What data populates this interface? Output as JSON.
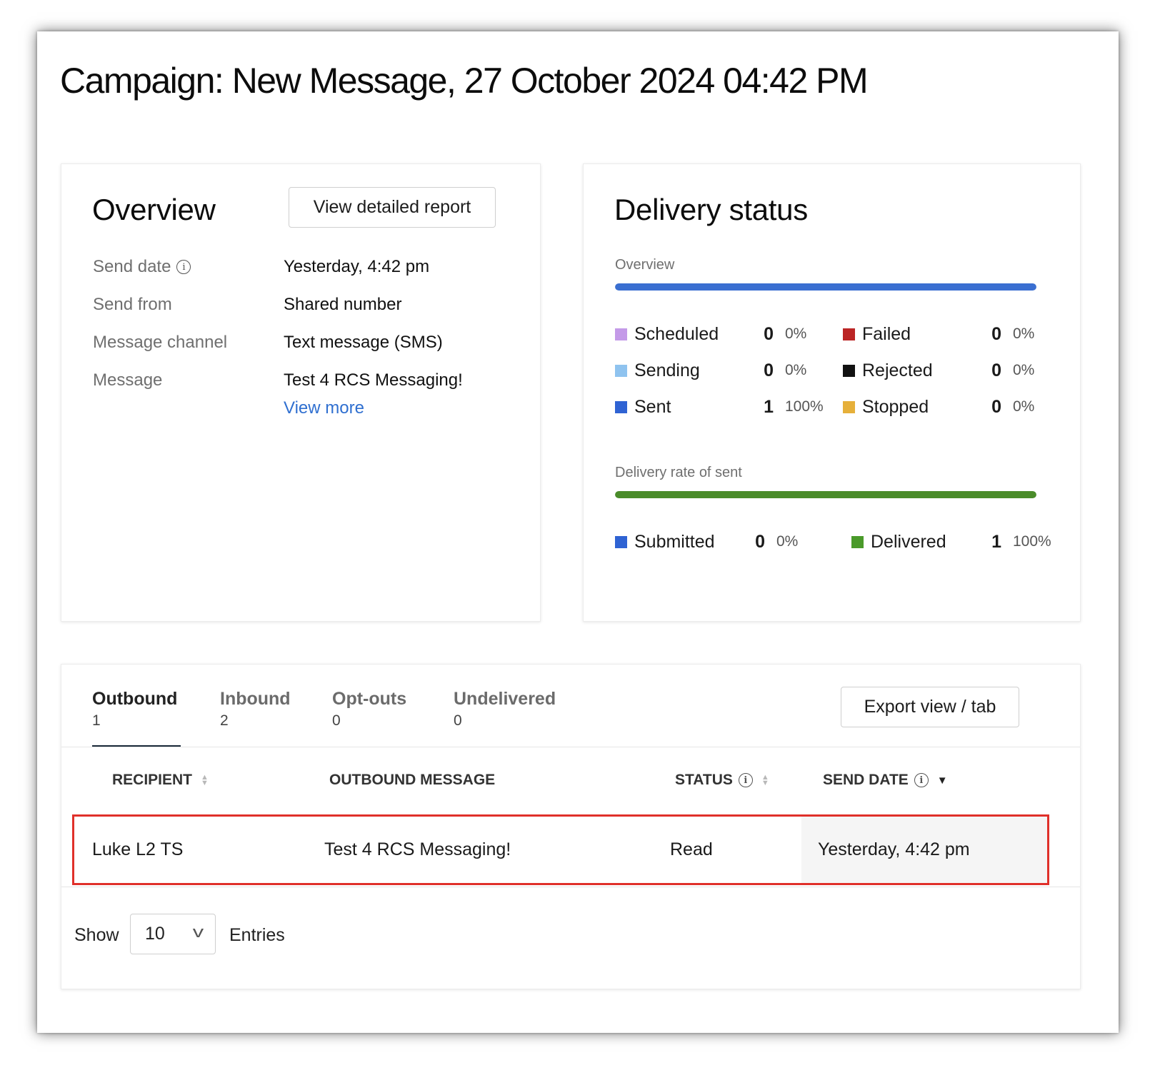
{
  "page": {
    "title": "Campaign: New Message, 27 October 2024 04:42 PM"
  },
  "overview": {
    "heading": "Overview",
    "report_button": "View detailed report",
    "fields": [
      {
        "label": "Send date",
        "value": "Yesterday, 4:42 pm"
      },
      {
        "label": "Send from",
        "value": "Shared number"
      },
      {
        "label": "Message channel",
        "value": "Text message (SMS)"
      },
      {
        "label": "Message",
        "value": "Test 4 RCS Messaging!"
      }
    ],
    "view_more": "View more",
    "info_icon": "info-icon"
  },
  "delivery": {
    "heading": "Delivery status",
    "overview_label": "Overview",
    "overview_bar": {
      "color": "#3a6fd1",
      "fill_percent": 100
    },
    "statuses": [
      {
        "name": "Scheduled",
        "count": "0",
        "pct": "0%",
        "color": "#c49ae8"
      },
      {
        "name": "Sending",
        "count": "0",
        "pct": "0%",
        "color": "#8fc3ef"
      },
      {
        "name": "Sent",
        "count": "1",
        "pct": "100%",
        "color": "#2f63d3"
      },
      {
        "name": "Failed",
        "count": "0",
        "pct": "0%",
        "color": "#bb2525"
      },
      {
        "name": "Rejected",
        "count": "0",
        "pct": "0%",
        "color": "#111111"
      },
      {
        "name": "Stopped",
        "count": "0",
        "pct": "0%",
        "color": "#e6b03a"
      }
    ],
    "rate_label": "Delivery rate of sent",
    "rate_bar": {
      "color": "#4a8c2a",
      "fill_percent": 100
    },
    "rates": [
      {
        "name": "Submitted",
        "count": "0",
        "pct": "0%",
        "color": "#2f63d3"
      },
      {
        "name": "Delivered",
        "count": "1",
        "pct": "100%",
        "color": "#4a9a2a"
      }
    ]
  },
  "tabs": [
    {
      "label": "Outbound",
      "count": "1",
      "active": true
    },
    {
      "label": "Inbound",
      "count": "2"
    },
    {
      "label": "Opt-outs",
      "count": "0"
    },
    {
      "label": "Undelivered",
      "count": "0"
    }
  ],
  "export_button": "Export view / tab",
  "table": {
    "columns": [
      "RECIPIENT",
      "OUTBOUND MESSAGE",
      "STATUS",
      "SEND DATE"
    ],
    "rows": [
      {
        "recipient": "Luke L2 TS",
        "message": "Test 4 RCS Messaging!",
        "status": "Read",
        "send_date": "Yesterday, 4:42 pm"
      }
    ],
    "highlight_color": "#e0302a"
  },
  "pagination": {
    "show_label": "Show",
    "page_size": "10",
    "entries_label": "Entries"
  }
}
